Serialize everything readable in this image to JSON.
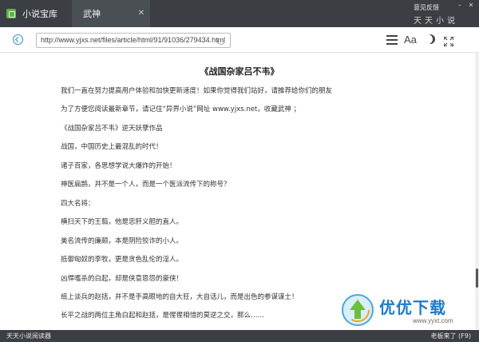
{
  "app": {
    "title": "小说宝库",
    "tab_label": "武神",
    "feedback": "意见反馈",
    "brand": "天天小说"
  },
  "nav": {
    "url": "http://www.yjxs.net/files/article/html/91/91036/279434.html"
  },
  "toolbar": {
    "font_label": "Aa"
  },
  "article": {
    "title": "《战国杂家吕不韦》",
    "paragraphs": [
      "我们一直在努力提高用户体验和加快更新速度！如果你觉得我们站好，请推荐给你们的朋友",
      "为了方便您阅读最新章节，请记住“异界小说”网址 www.yjxs.net，收藏武神 ；",
      "《战国杂家吕不韦》逆天妖孽作品",
      "战国，中国历史上最混乱的时代！",
      "诸子百家，各思想学说大爆炸的开始！",
      "神医扁鹊，并不是一个人，而是一个医派流传下的称号？",
      "四大名将：",
      "横扫天下的王翦，他是忠肝义胆的直人。",
      "美名流传的廉颇，本是阴险狡诈的小人。",
      "抵御匈奴的李牧，更是贪色乱伦的淫人。",
      "凶悍嗜杀的白起，却是侠意恩怨的豪侠！",
      "纸上谈兵的赵括，并不是手高眼地的自大狂，大自话儿，而是出色的参谋谋士！",
      "长平之战的两位主角白起和赵括，是惺惺相惜的莫逆之交，那么……"
    ]
  },
  "watermark": {
    "title": "优优下载",
    "url": "www.yyxt.com"
  },
  "status": {
    "left": "天天小说阅读器",
    "right": "老板来了 (F9)"
  }
}
